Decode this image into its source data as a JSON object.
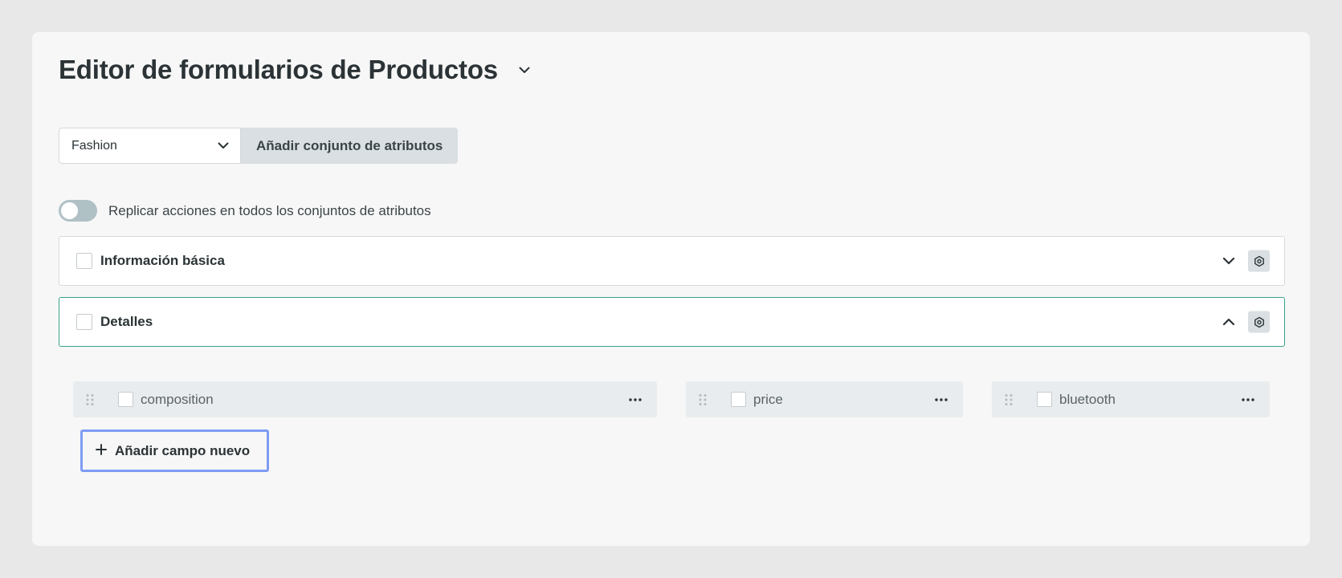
{
  "page": {
    "title": "Editor de formularios de Productos"
  },
  "attribute_set": {
    "selected": "Fashion",
    "add_button_label": "Añadir conjunto de atributos"
  },
  "replicate_toggle": {
    "label": "Replicar acciones en todos los conjuntos de atributos",
    "on": false
  },
  "sections": [
    {
      "title": "Información básica",
      "expanded": false
    },
    {
      "title": "Detalles",
      "expanded": true
    }
  ],
  "fields": [
    {
      "label": "composition"
    },
    {
      "label": "price"
    },
    {
      "label": "bluetooth"
    }
  ],
  "add_field_button": {
    "label": "Añadir campo nuevo"
  },
  "colors": {
    "page_background": "#e8e8e8",
    "card_background": "#f7f7f7",
    "active_section_border": "#3aa28b",
    "focus_outline": "#7f9cf5",
    "secondary_button": "#d9dfe2",
    "toggle_off": "#b0c1c6"
  },
  "icons": {
    "title_dropdown": "chevron-down-icon",
    "select_dropdown": "chevron-down-icon",
    "section_collapsed": "chevron-down-icon",
    "section_expanded": "chevron-up-icon",
    "section_settings": "gear-icon",
    "field_drag": "drag-handle-icon",
    "field_menu": "more-icon",
    "add_field": "plus-icon"
  }
}
